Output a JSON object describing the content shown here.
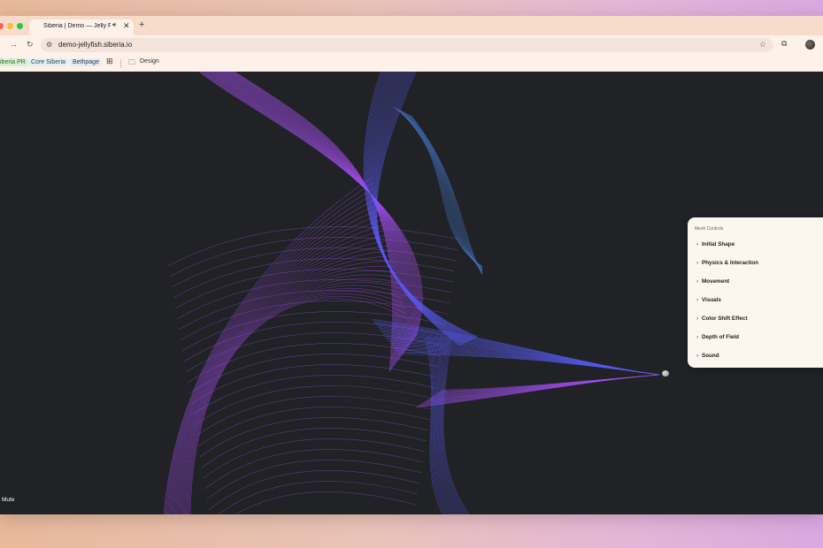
{
  "browser": {
    "tab": {
      "title": "Siberia | Demo — Jelly Fish",
      "audio_icon": "speaker-icon",
      "close_glyph": "✕"
    },
    "new_tab_glyph": "+",
    "nav": {
      "forward_glyph": "→",
      "reload_glyph": "↻"
    },
    "url": "demo-jellyfish.siberia.io",
    "bookmarks": [
      {
        "label": "iberia PR"
      },
      {
        "label": "Core Siberia"
      },
      {
        "label": "Bethpage"
      },
      {
        "label": "Design"
      }
    ],
    "colors": {
      "traffic_red": "#ff5f57",
      "traffic_yellow": "#febc2e",
      "traffic_green": "#28c840"
    }
  },
  "scene": {
    "background": "#212225",
    "mute_label": "Mute",
    "colors": {
      "violet": "#a450f0",
      "blue": "#5a5cf5",
      "steel_blue": "#4a7ed6"
    }
  },
  "panel": {
    "title": "Mesh Controls",
    "items": [
      {
        "label": "Initial Shape"
      },
      {
        "label": "Physics & Interaction"
      },
      {
        "label": "Movement"
      },
      {
        "label": "Visuals"
      },
      {
        "label": "Color Shift Effect"
      },
      {
        "label": "Depth of Field"
      },
      {
        "label": "Sound"
      }
    ]
  }
}
